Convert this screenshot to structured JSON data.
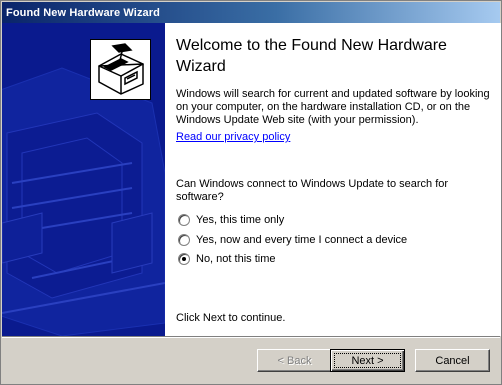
{
  "window": {
    "title": "Found New Hardware Wizard"
  },
  "sidebar": {
    "icon": "hardware-wizard-icon",
    "panel_color": "#0a1a8e"
  },
  "main": {
    "heading": "Welcome to the Found New Hardware Wizard",
    "description": "Windows will search for current and updated software by looking on your computer, on the hardware installation CD, or on the Windows Update Web site (with your permission).",
    "privacy_link": "Read our privacy policy",
    "question": "Can Windows connect to Windows Update to search for software?",
    "options": [
      {
        "label": "Yes, this time only",
        "selected": false
      },
      {
        "label": "Yes, now and every time I connect a device",
        "selected": false
      },
      {
        "label": "No, not this time",
        "selected": true
      }
    ],
    "footer": "Click Next to continue."
  },
  "buttons": {
    "back": "< Back",
    "next": "Next >",
    "cancel": "Cancel"
  },
  "colors": {
    "title_gradient_start": "#0a246a",
    "title_gradient_end": "#a6caf0",
    "link": "#0000ff",
    "dialog_face": "#d4d0c8"
  }
}
